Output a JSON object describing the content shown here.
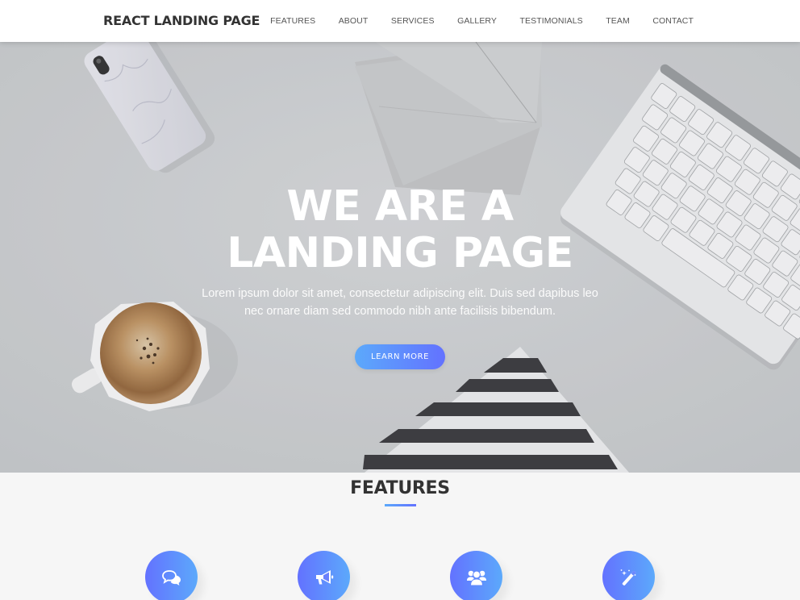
{
  "navbar": {
    "brand": "REACT LANDING PAGE",
    "links": [
      {
        "label": "FEATURES"
      },
      {
        "label": "ABOUT"
      },
      {
        "label": "SERVICES"
      },
      {
        "label": "GALLERY"
      },
      {
        "label": "TESTIMONIALS"
      },
      {
        "label": "TEAM"
      },
      {
        "label": "CONTACT"
      }
    ]
  },
  "hero": {
    "title_line1": "WE ARE A",
    "title_line2": "LANDING PAGE",
    "subtitle": "Lorem ipsum dolor sit amet, consectetur adipiscing elit. Duis sed dapibus leo nec ornare diam sed commodo nibh ante facilisis bibendum.",
    "cta_label": "LEARN MORE",
    "background_objects": [
      "phone",
      "envelope",
      "keyboard",
      "coffee-cup",
      "striped-triangle"
    ]
  },
  "features": {
    "title": "FEATURES",
    "icons": [
      {
        "name": "comments-icon"
      },
      {
        "name": "bullhorn-icon"
      },
      {
        "name": "group-icon"
      },
      {
        "name": "magic-wand-icon"
      }
    ]
  },
  "colors": {
    "gradient_start": "#5ca9fb",
    "gradient_end": "#6372ff",
    "heading": "#333333",
    "nav_text": "#555555",
    "section_bg": "#f6f6f6"
  }
}
